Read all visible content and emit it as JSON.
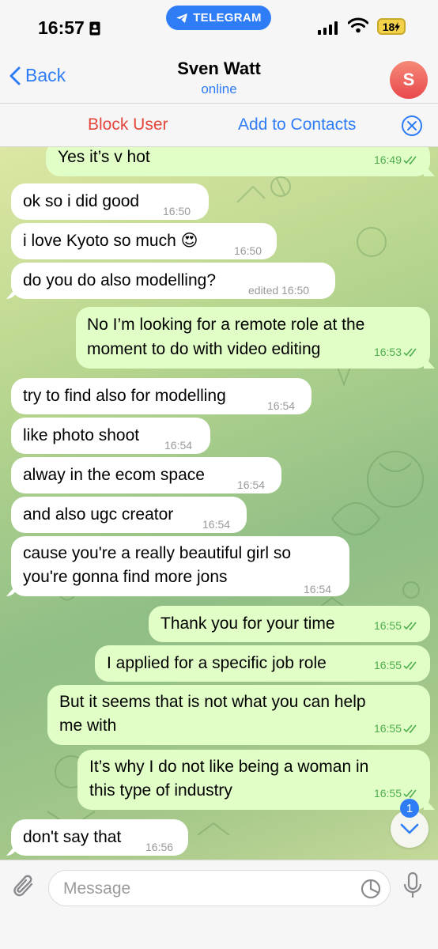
{
  "status_bar": {
    "time": "16:57",
    "app_badge": "TELEGRAM",
    "battery": "18"
  },
  "nav": {
    "back_label": "Back",
    "title": "Sven Watt",
    "subtitle": "online",
    "avatar_letter": "S"
  },
  "actions": {
    "block_label": "Block User",
    "add_label": "Add to Contacts"
  },
  "messages": [
    {
      "dir": "out",
      "text": "Yes it’s v hot",
      "time": "16:49"
    },
    {
      "dir": "in",
      "text": "ok so i did good",
      "time": "16:50"
    },
    {
      "dir": "in",
      "text": "i love Kyoto so much 😍",
      "time": "16:50"
    },
    {
      "dir": "in",
      "text": "do you do also modelling?",
      "time": "edited 16:50"
    },
    {
      "dir": "out",
      "line1": "No I’m looking for a remote role at the",
      "line2": "moment to do with video editing",
      "time": "16:53"
    },
    {
      "dir": "in",
      "text": "try to find also for modelling",
      "time": "16:54"
    },
    {
      "dir": "in",
      "text": "like photo shoot",
      "time": "16:54"
    },
    {
      "dir": "in",
      "text": "alway in the ecom space",
      "time": "16:54"
    },
    {
      "dir": "in",
      "text": "and also ugc creator",
      "time": "16:54"
    },
    {
      "dir": "in",
      "line1": "cause you're a really beautiful girl so",
      "line2": "you're gonna find more jons",
      "time": "16:54"
    },
    {
      "dir": "out",
      "text": "Thank you for your time",
      "time": "16:55"
    },
    {
      "dir": "out",
      "text": "I applied for a specific job role",
      "time": "16:55"
    },
    {
      "dir": "out",
      "line1": "But it seems that is not what you can help",
      "line2": "me with",
      "time": "16:55"
    },
    {
      "dir": "out",
      "line1": "It’s why I do not like being a woman in",
      "line2": "this type of industry",
      "time": "16:55"
    },
    {
      "dir": "in",
      "text": "don't say that",
      "time": "16:56"
    }
  ],
  "scroll": {
    "unread_count": "1"
  },
  "composer": {
    "placeholder": "Message"
  },
  "colors": {
    "accent": "#2f7df6",
    "danger": "#e5453b",
    "incoming_bubble": "#ffffff",
    "outgoing_bubble": "#e1fec6",
    "read_check": "#4fae4e"
  }
}
